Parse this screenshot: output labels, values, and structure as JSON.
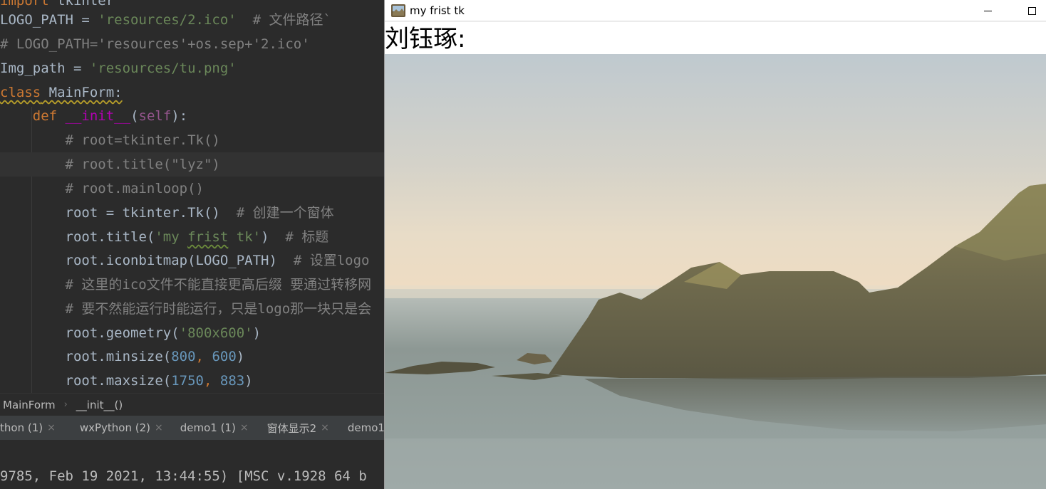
{
  "editor": {
    "lines": [
      {
        "parts": [
          {
            "t": "import",
            "c": "kw"
          },
          {
            "t": " tkinter",
            "c": ""
          }
        ]
      },
      {
        "parts": [
          {
            "t": "LOGO_PATH = ",
            "c": ""
          },
          {
            "t": "'resources/2.ico'",
            "c": "str"
          },
          {
            "t": "  # 文件路径`",
            "c": "cmt"
          }
        ]
      },
      {
        "parts": [
          {
            "t": "# LOGO_PATH='resources'+os.sep+'2.ico'",
            "c": "cmt"
          }
        ]
      },
      {
        "parts": [
          {
            "t": "Img_path = ",
            "c": ""
          },
          {
            "t": "'resources/tu.png'",
            "c": "str"
          }
        ]
      },
      {
        "parts": [
          {
            "t": "class",
            "c": "kw wavy-y"
          },
          {
            "t": " MainForm:",
            "c": "wavy-y"
          }
        ]
      },
      {
        "parts": [
          {
            "t": "    ",
            "c": ""
          },
          {
            "t": "def",
            "c": "kw"
          },
          {
            "t": " ",
            "c": ""
          },
          {
            "t": "__init__",
            "c": "magic"
          },
          {
            "t": "(",
            "c": ""
          },
          {
            "t": "self",
            "c": "self"
          },
          {
            "t": "):",
            "c": ""
          }
        ]
      },
      {
        "parts": [
          {
            "t": "        # root=tkinter.Tk()",
            "c": "cmt"
          }
        ]
      },
      {
        "parts": [
          {
            "t": "        # root.title(\"lyz\")",
            "c": "cmt"
          }
        ]
      },
      {
        "parts": [
          {
            "t": "        # root.mainloop()",
            "c": "cmt"
          }
        ]
      },
      {
        "parts": [
          {
            "t": "        root = tkinter.Tk()",
            "c": ""
          },
          {
            "t": "  # 创建一个窗体",
            "c": "cmt"
          }
        ]
      },
      {
        "parts": [
          {
            "t": "        root.title(",
            "c": ""
          },
          {
            "t": "'my ",
            "c": "str"
          },
          {
            "t": "frist",
            "c": "str wavy"
          },
          {
            "t": " tk'",
            "c": "str"
          },
          {
            "t": ")",
            "c": ""
          },
          {
            "t": "  # 标题",
            "c": "cmt"
          }
        ]
      },
      {
        "parts": [
          {
            "t": "        root.iconbitmap(LOGO_PATH)",
            "c": ""
          },
          {
            "t": "  # 设置logo",
            "c": "cmt"
          }
        ]
      },
      {
        "parts": [
          {
            "t": "        # 这里的ico文件不能直接更高后缀 要通过转移网",
            "c": "cmt"
          }
        ]
      },
      {
        "parts": [
          {
            "t": "        # 要不然能运行时能运行，只是logo那一块只是会",
            "c": "cmt"
          }
        ]
      },
      {
        "parts": [
          {
            "t": "        root.geometry(",
            "c": ""
          },
          {
            "t": "'800x600'",
            "c": "str"
          },
          {
            "t": ")",
            "c": ""
          }
        ]
      },
      {
        "parts": [
          {
            "t": "        root.minsize(",
            "c": ""
          },
          {
            "t": "800",
            "c": "num"
          },
          {
            "t": ", ",
            "c": "kw"
          },
          {
            "t": "600",
            "c": "num"
          },
          {
            "t": ")",
            "c": ""
          }
        ]
      },
      {
        "parts": [
          {
            "t": "        root.maxsize(",
            "c": ""
          },
          {
            "t": "1750",
            "c": "num"
          },
          {
            "t": ", ",
            "c": "kw"
          },
          {
            "t": "883",
            "c": "num"
          },
          {
            "t": ")",
            "c": ""
          }
        ]
      }
    ]
  },
  "breadcrumb": {
    "class_name": "MainForm",
    "method_name": "__init__()"
  },
  "tabs": [
    {
      "label": "thon (1)"
    },
    {
      "label": "wxPython (2)"
    },
    {
      "label": "demo1 (1)"
    },
    {
      "label": "窗体显示2"
    },
    {
      "label": "demo1"
    }
  ],
  "tab_close_glyph": "×",
  "console": {
    "text": "9785, Feb 19 2021, 13:44:55) [MSC v.1928 64 b"
  },
  "tk_window": {
    "title": "my frist tk",
    "minimize_icon": "minimize-icon",
    "maximize_icon": "maximize-icon",
    "label_text": "刘钰琢:"
  },
  "colors": {
    "editor_bg": "#2b2b2b",
    "keyword": "#cc7832",
    "string": "#6a8759",
    "comment": "#808080",
    "number": "#6897bb",
    "self": "#94558d",
    "magic": "#b200b2"
  }
}
